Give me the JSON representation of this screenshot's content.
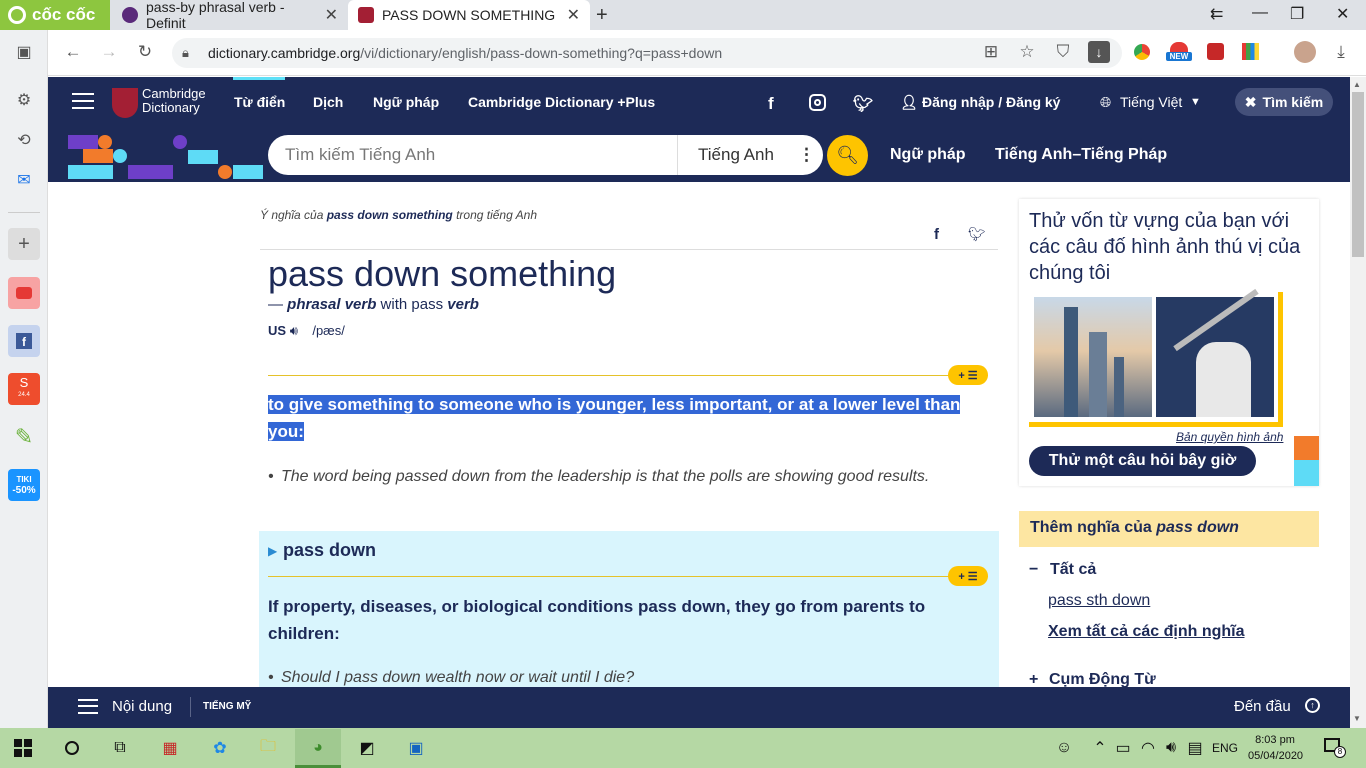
{
  "browser": {
    "logo": "cốc cốc",
    "tabs": [
      {
        "title": "pass-by phrasal verb - Definit"
      },
      {
        "title": "PASS DOWN SOMETHING | Đ"
      }
    ],
    "url_domain": "dictionary.cambridge.org",
    "url_rest": "/vi/dictionary/english/pass-down-something?q=pass+down",
    "new_badge": "NEW"
  },
  "sidebar": {
    "shopee_badge": "24.4",
    "tiki_label": "TIKI",
    "tiki_discount": "-50%"
  },
  "site": {
    "brand_line1": "Cambridge",
    "brand_line2": "Dictionary",
    "nav": [
      "Từ điển",
      "Dịch",
      "Ngữ pháp",
      "Cambridge Dictionary +Plus"
    ],
    "login": "Đăng nhập / Đăng ký",
    "language": "Tiếng Việt",
    "search_toggle": "Tìm kiếm",
    "search_placeholder": "Tìm kiếm Tiếng Anh",
    "search_lang": "Tiếng Anh",
    "nav2": [
      "Ngữ pháp",
      "Tiếng Anh–Tiếng Pháp"
    ]
  },
  "entry": {
    "crumb_prefix": "Ý nghĩa của ",
    "crumb_word": "pass down something",
    "crumb_suffix": " trong tiếng Anh",
    "headword": "pass down something",
    "pos_dash": "— ",
    "pos": "phrasal verb",
    "pos_with": " with pass ",
    "pos_verb": "verb",
    "region": "US",
    "ipa": "/pæs/",
    "definition": "to give something to someone who is younger, less important, or at a lower level than you:",
    "example": "The word being passed down from the leadership is that the polls are showing good results.",
    "pv_title": "pass down",
    "pv_definition": "If property, diseases, or biological conditions pass down, they go from parents to children:",
    "pv_example": "Should I pass down wealth now or wait until I die?"
  },
  "right": {
    "quiz_text": "Thử vốn từ vựng của bạn với các câu đố hình ảnh thú vị của chúng tôi",
    "copyright": "Bản quyền hình ảnh",
    "quiz_button": "Thử một câu hỏi bây giờ",
    "more_prefix": "Thêm nghĩa của ",
    "more_word": "pass down",
    "all_label": "Tất cả",
    "link1": "pass sth down",
    "link2": "Xem tất cả các định nghĩa",
    "phrasal": "Cụm Động Từ"
  },
  "bottombar": {
    "contents": "Nội dung",
    "dialect": "TIẾNG MỸ",
    "top": "Đến đầu"
  },
  "taskbar": {
    "lang": "ENG",
    "time": "8:03 pm",
    "date": "05/04/2020",
    "notif": "8"
  }
}
